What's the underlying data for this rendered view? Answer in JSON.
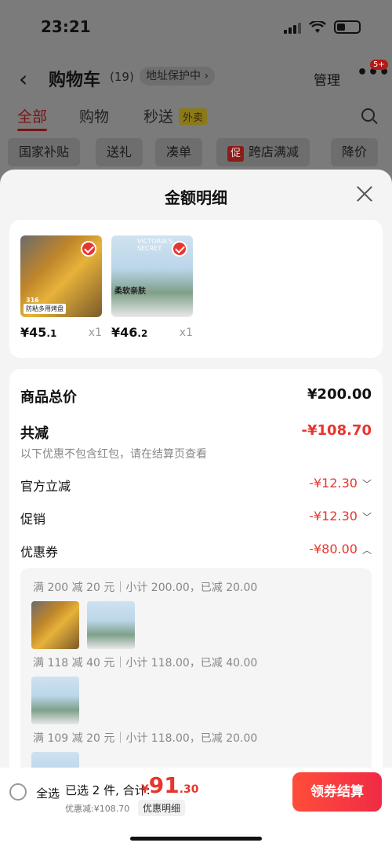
{
  "status": {
    "time": "23:21"
  },
  "nav": {
    "title": "购物车",
    "count": "(19)",
    "address": "地址保护中 ›",
    "manage": "管理",
    "more": "•••",
    "badge": "5+"
  },
  "tabs": [
    {
      "label": "全部"
    },
    {
      "label": "购物"
    },
    {
      "label": "秒送"
    }
  ],
  "tab_badge": "外卖",
  "chips": [
    {
      "label": "国家补贴"
    },
    {
      "label": "送礼"
    },
    {
      "label": "凑单"
    },
    {
      "label": "跨店满减"
    },
    {
      "label": "降价"
    }
  ],
  "chip_icon": "促",
  "sheet": {
    "title": "金额明细",
    "items": [
      {
        "image": "baking-tray",
        "price_int": "¥45",
        "price_dec": ".1",
        "qty": "x1",
        "tag": "防粘多用烤盘",
        "tag_sub": "316"
      },
      {
        "image": "bra-model",
        "price_int": "¥46",
        "price_dec": ".2",
        "qty": "x1",
        "tag": "柔软亲肤",
        "tag_sub": "VICTORIA'S SECRET"
      }
    ],
    "total_label": "商品总价",
    "total_value": "¥200.00",
    "reduce_label": "共减",
    "reduce_value": "-¥108.70",
    "note": "以下优惠不包含红包，请在结算页查看",
    "discounts": [
      {
        "label": "官方立减",
        "value": "-¥12.30",
        "chev": "﹀"
      },
      {
        "label": "促销",
        "value": "-¥12.30",
        "chev": "﹀"
      },
      {
        "label": "优惠券",
        "value": "-¥80.00",
        "chev": "︿"
      }
    ],
    "coupons": [
      {
        "text": "满 200 减 20 元｜小计 200.00，已减 20.00"
      },
      {
        "text": "满 118 减 40 元｜小计 118.00，已减 40.00"
      },
      {
        "text": "满 109 减 20 元｜小计 118.00，已减 20.00"
      }
    ]
  },
  "bottom": {
    "select_all": "全选",
    "selected_text": "已选 2 件, 合计:",
    "sum_currency": "¥",
    "sum_int": "91",
    "sum_dec": ".30",
    "discount_text": "优惠减:¥108.70",
    "detail_link": "优惠明细",
    "checkout": "领券结算"
  },
  "colors": {
    "accent": "#e8352e",
    "checkout_start": "#ff4d3a",
    "checkout_end": "#f02b45"
  }
}
